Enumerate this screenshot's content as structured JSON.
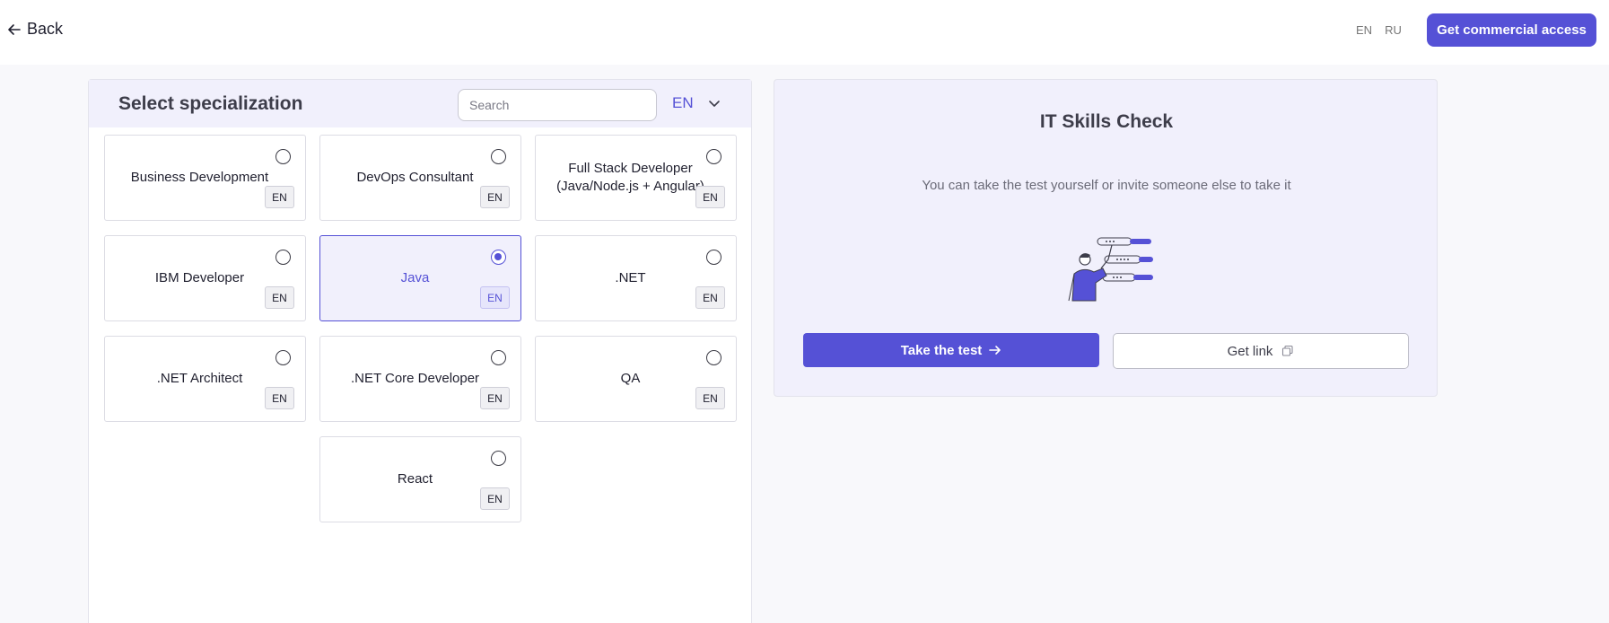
{
  "header": {
    "back_label": "Back",
    "languages": [
      "EN",
      "RU"
    ],
    "commercial_label": "Get commercial access"
  },
  "specialization": {
    "title": "Select specialization",
    "search_placeholder": "Search",
    "language": "EN",
    "items": [
      {
        "name": "Business Development",
        "lang": "EN",
        "selected": false
      },
      {
        "name": "DevOps Consultant",
        "lang": "EN",
        "selected": false
      },
      {
        "name": "Full Stack Developer (Java/Node.js + Angular)",
        "lang": "EN",
        "selected": false
      },
      {
        "name": "IBM Developer",
        "lang": "EN",
        "selected": false
      },
      {
        "name": "Java",
        "lang": "EN",
        "selected": true
      },
      {
        "name": ".NET",
        "lang": "EN",
        "selected": false
      },
      {
        "name": ".NET Architect",
        "lang": "EN",
        "selected": false
      },
      {
        "name": ".NET Core Developer",
        "lang": "EN",
        "selected": false
      },
      {
        "name": "QA",
        "lang": "EN",
        "selected": false
      },
      {
        "name": "React",
        "lang": "EN",
        "selected": false
      }
    ]
  },
  "skills_check": {
    "title": "IT Skills Check",
    "subtitle": "You can take the test yourself or invite someone else to take it",
    "take_label": "Take the test",
    "link_label": "Get link"
  },
  "colors": {
    "accent": "#5551d6",
    "panel_tint": "#f1f0fc"
  }
}
